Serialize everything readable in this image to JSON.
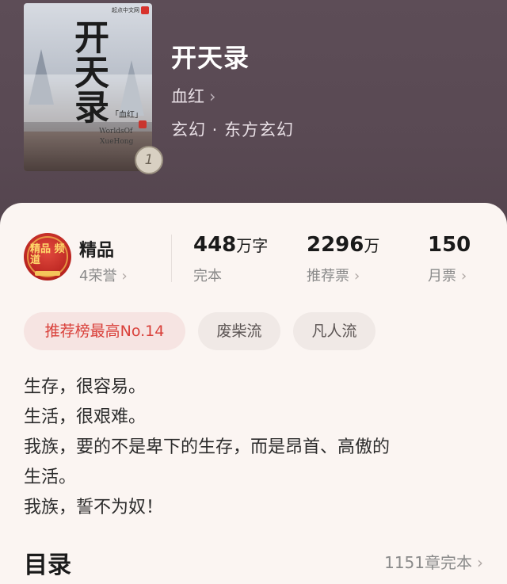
{
  "book": {
    "title": "开天录",
    "author": "血红",
    "genre": "玄幻 · 东方玄幻",
    "volume_badge": "1",
    "cover": {
      "title_art": "开天录",
      "author_art": "「血红」",
      "english_title": "WorldsOf",
      "english_author": "XueHong",
      "publisher": "起点中文网"
    }
  },
  "quality": {
    "label": "精品",
    "honor": "4荣誉",
    "badge_text": "精品 频道"
  },
  "stats": [
    {
      "value": "448",
      "unit": "万字",
      "label": "完本"
    },
    {
      "value": "2296",
      "unit": "万",
      "label": "推荐票"
    },
    {
      "value": "150",
      "unit": "",
      "label": "月票"
    }
  ],
  "tags": [
    "推荐榜最高No.14",
    "废柴流",
    "凡人流"
  ],
  "description": [
    "生存，很容易。",
    "生活，很艰难。",
    "我族，要的不是卑下的生存，而是昂首、高傲的",
    "生活。",
    "我族，誓不为奴！"
  ],
  "toc": {
    "title": "目录",
    "info": "1151章完本"
  },
  "colors": {
    "accent": "#d9403a",
    "card_bg": "#fbf5f2",
    "hero_bg": "#5a4a52"
  },
  "icons": {
    "chevron": "chevron-right-icon"
  }
}
